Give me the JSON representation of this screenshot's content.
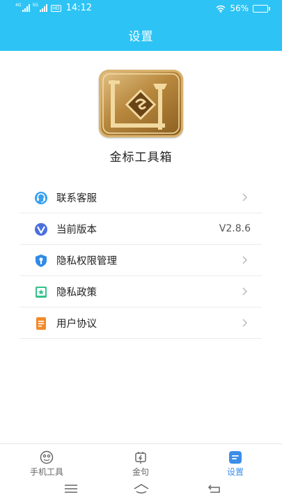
{
  "status_bar": {
    "network_1": "4G",
    "network_2": "5G",
    "hd_badge": "HD",
    "time": "14:12",
    "battery_text": "56%",
    "battery_level": 0.56
  },
  "header": {
    "title": "设置"
  },
  "app": {
    "name": "金标工具箱",
    "logo_icon": "toolbox-logo"
  },
  "menu": {
    "items": [
      {
        "label": "联系客服",
        "icon": "headset-icon",
        "color": "#3aa0f0"
      },
      {
        "label": "当前版本",
        "icon": "version-icon",
        "color": "#4a6fe0",
        "value": "V2.8.6"
      },
      {
        "label": "隐私权限管理",
        "icon": "shield-icon",
        "color": "#2f8be6"
      },
      {
        "label": "隐私政策",
        "icon": "star-book-icon",
        "color": "#35c28a"
      },
      {
        "label": "用户协议",
        "icon": "document-icon",
        "color": "#f28a2a"
      }
    ]
  },
  "tabs": [
    {
      "label": "手机工具",
      "icon": "tools-icon"
    },
    {
      "label": "金句",
      "icon": "quote-icon"
    },
    {
      "label": "设置",
      "icon": "settings-icon",
      "active": true
    }
  ],
  "colors": {
    "header": "#2ec3f5",
    "active_tab": "#3b8ee8"
  }
}
